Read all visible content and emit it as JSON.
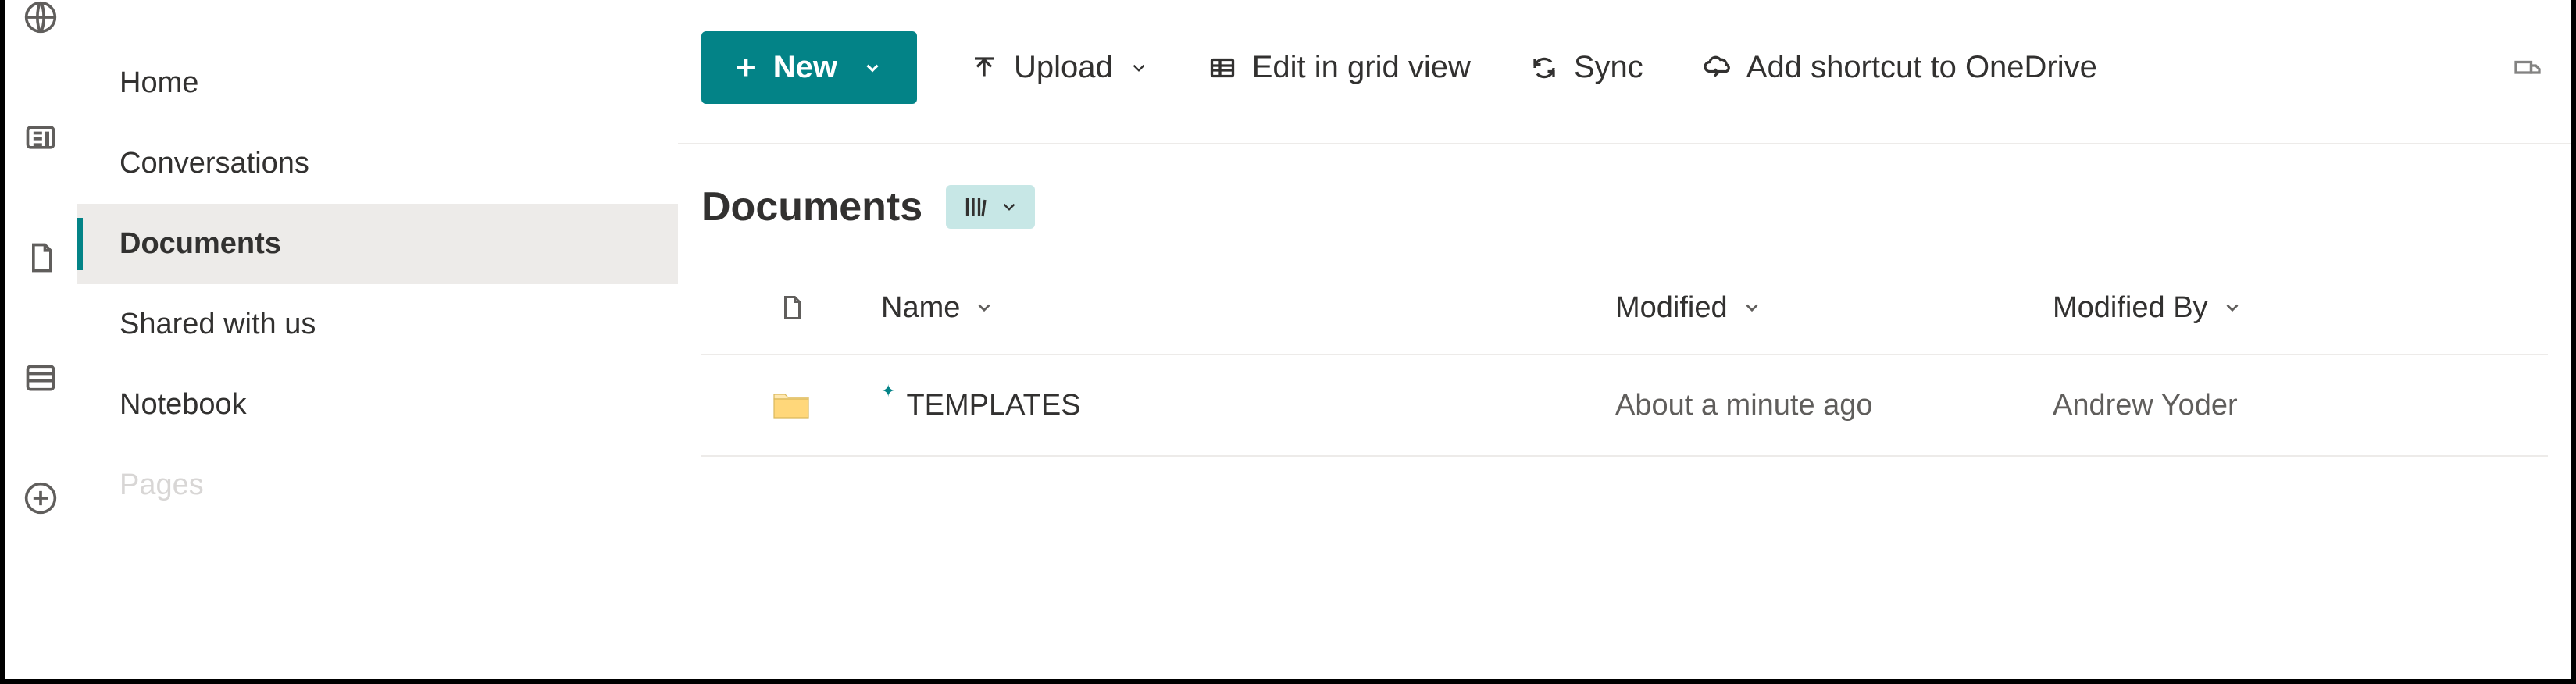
{
  "rail": {
    "items": [
      "globe-icon",
      "news-icon",
      "file-icon",
      "list-icon",
      "add-icon"
    ]
  },
  "sidebar": {
    "items": [
      {
        "label": "Home",
        "active": false
      },
      {
        "label": "Conversations",
        "active": false
      },
      {
        "label": "Documents",
        "active": true
      },
      {
        "label": "Shared with us",
        "active": false
      },
      {
        "label": "Notebook",
        "active": false
      },
      {
        "label": "Pages",
        "active": false
      }
    ]
  },
  "toolbar": {
    "new_label": "New",
    "upload_label": "Upload",
    "grid_label": "Edit in grid view",
    "sync_label": "Sync",
    "shortcut_label": "Add shortcut to OneDrive"
  },
  "page": {
    "title": "Documents"
  },
  "columns": {
    "name": "Name",
    "modified": "Modified",
    "modified_by": "Modified By"
  },
  "rows": [
    {
      "type": "folder",
      "name": "TEMPLATES",
      "is_new": true,
      "modified": "About a minute ago",
      "modified_by": "Andrew Yoder"
    }
  ],
  "colors": {
    "accent": "#038387",
    "folder_fill": "#ffd77a",
    "folder_back": "#ffe8b0"
  }
}
